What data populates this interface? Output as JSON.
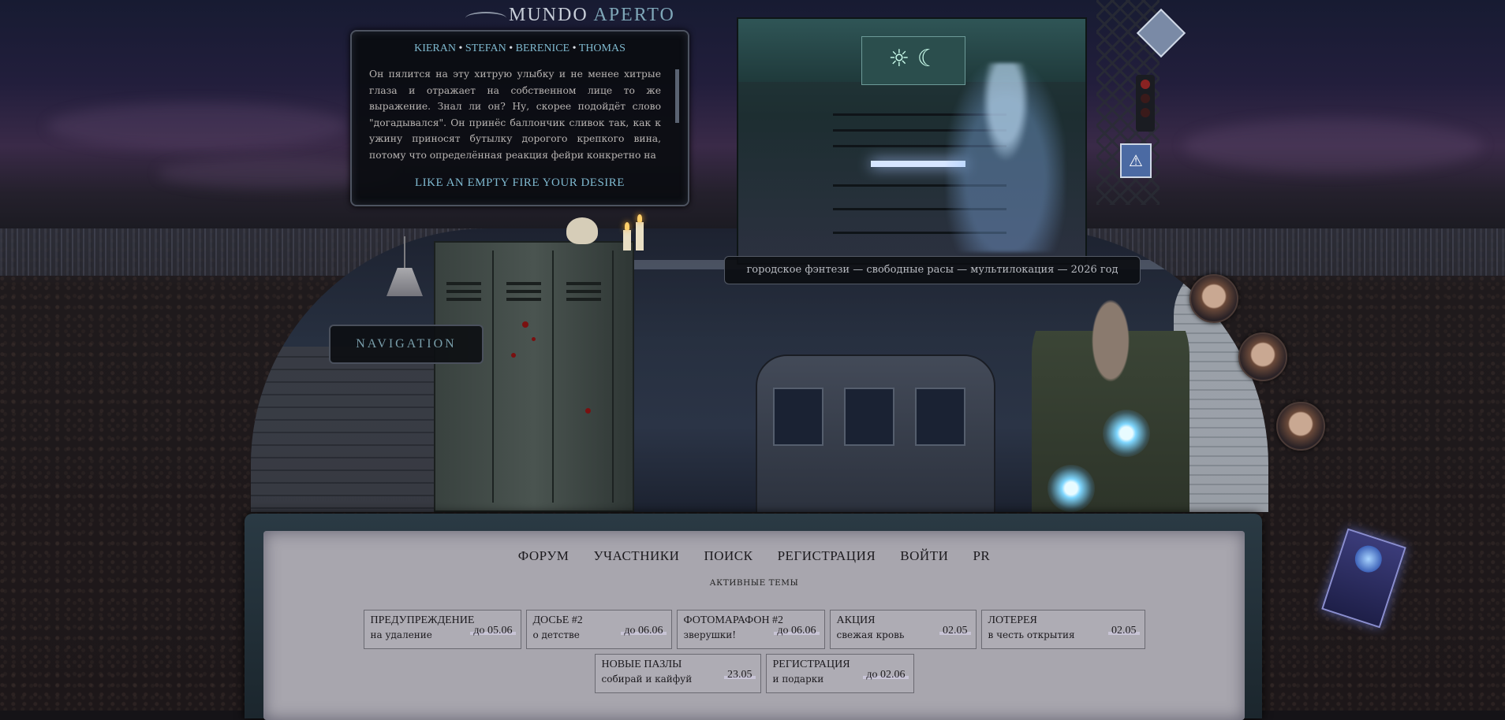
{
  "logo": {
    "part1": "MUNDO",
    "part2": "APERTO"
  },
  "story": {
    "names": [
      "KIERAN",
      "STEFAN",
      "BERENICE",
      "THOMAS"
    ],
    "separator": "•",
    "text": "Он пялится на эту хитрую улыбку и не менее хитрые глаза и отражает на собственном лице то же выражение. Знал ли он? Ну, скорее подойдёт слово \"догадывался\". Он принёс баллончик сливок так, как к ужину приносят бутылку дорогого крепкого вина, потому что определённая реакция фейри конкретно на",
    "footer": "LIKE AN EMPTY FIRE YOUR DESIRE"
  },
  "tagline": "городское фэнтези — свободные расы — мультилокация — 2026 год",
  "nav_label": "NAVIGATION",
  "menu": [
    "ФОРУМ",
    "УЧАСТНИКИ",
    "ПОИСК",
    "РЕГИСТРАЦИЯ",
    "ВОЙТИ",
    "PR"
  ],
  "active_title": "АКТИВНЫЕ ТЕМЫ",
  "topics_row1": [
    {
      "title": "ПРЕДУПРЕЖДЕНИЕ",
      "subtitle": "на удаление",
      "date": "до 05.06"
    },
    {
      "title": "ДОСЬЕ #2",
      "subtitle": "о детстве",
      "date": "до 06.06"
    },
    {
      "title": "ФОТОМАРАФОН #2",
      "subtitle": "зверушки!",
      "date": "до 06.06"
    },
    {
      "title": "АКЦИЯ",
      "subtitle": "свежая кровь",
      "date": "02.05"
    },
    {
      "title": "ЛОТЕРЕЯ",
      "subtitle": "в честь открытия",
      "date": "02.05"
    }
  ],
  "topics_row2": [
    {
      "title": "НОВЫЕ ПАЗЛЫ",
      "subtitle": "собирай и кайфуй",
      "date": "23.05"
    },
    {
      "title": "РЕГИСТРАЦИЯ",
      "subtitle": "и подарки",
      "date": "до 02.06"
    }
  ],
  "icons": {
    "emblem": "sun-and-moon-icon",
    "pedestrian_sign": "pedestrian-crossing-icon"
  }
}
